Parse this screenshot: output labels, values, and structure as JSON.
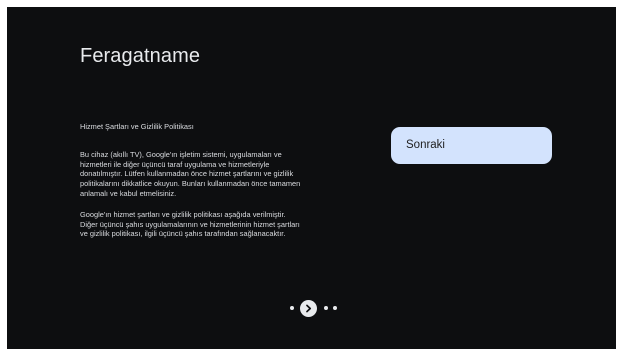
{
  "screen": {
    "title": "Feragatname"
  },
  "document": {
    "heading": "Hizmet Şartları ve Gizlilik Politikası",
    "paragraphs": [
      {
        "lines": [
          "Bu cihaz (akıllı TV), Google'ın işletim sistemi, uygulamaları ve",
          "hizmetleri ile diğer üçüncü taraf uygulama ve hizmetleriyle",
          "donatılmıştır. Lütfen kullanmadan önce hizmet şartlarını ve gizlilik",
          "politikalarını dikkatlice okuyun. Bunları kullanmadan önce tamamen",
          "anlamalı ve kabul etmelisiniz."
        ]
      },
      {
        "lines": [
          "Google'ın hizmet şartları ve gizlilik politikası aşağıda verilmiştir.",
          "Diğer üçüncü şahıs uygulamalarının ve hizmetlerinin hizmet şartları",
          "ve gizlilik politikası, ilgili üçüncü şahıs tarafından sağlanacaktır."
        ]
      }
    ]
  },
  "actions": {
    "next_label": "Sonraki"
  },
  "pager": {
    "dots_before": 1,
    "dots_after": 2,
    "current_icon": "chevron-right-icon"
  },
  "colors": {
    "background": "#0d0e10",
    "title_text": "#e8eaed",
    "body_text": "#dadce0",
    "button_focus_bg": "#d3e3fd",
    "button_text": "#1f1f1f"
  }
}
